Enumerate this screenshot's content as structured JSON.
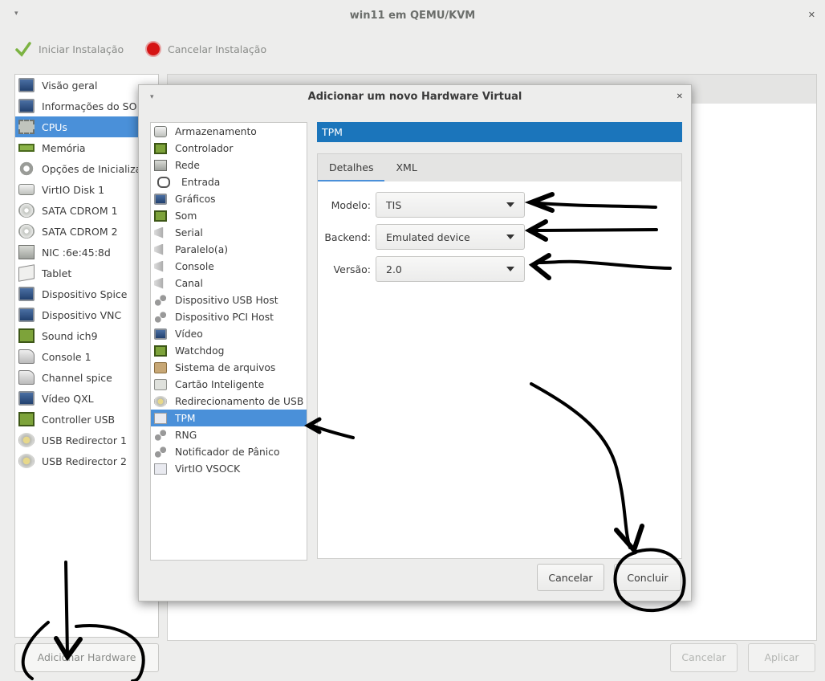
{
  "window": {
    "title": "win11 em QEMU/KVM"
  },
  "toolbar": {
    "start_label": "Iniciar Instalação",
    "cancel_label": "Cancelar Instalação"
  },
  "sidebar": {
    "items": [
      {
        "label": "Visão geral",
        "icon": "monitor-icon"
      },
      {
        "label": "Informações do SO",
        "icon": "monitor-icon"
      },
      {
        "label": "CPUs",
        "icon": "cpu-icon",
        "selected": true
      },
      {
        "label": "Memória",
        "icon": "memory-icon"
      },
      {
        "label": "Opções de Inicializa",
        "icon": "boot-icon"
      },
      {
        "label": "VirtIO Disk 1",
        "icon": "disk-icon"
      },
      {
        "label": "SATA CDROM 1",
        "icon": "cdrom-icon"
      },
      {
        "label": "SATA CDROM 2",
        "icon": "cdrom-icon"
      },
      {
        "label": "NIC :6e:45:8d",
        "icon": "nic-icon"
      },
      {
        "label": "Tablet",
        "icon": "tablet-icon"
      },
      {
        "label": "Dispositivo Spice",
        "icon": "monitor-icon"
      },
      {
        "label": "Dispositivo VNC",
        "icon": "monitor-icon"
      },
      {
        "label": "Sound ich9",
        "icon": "sound-icon"
      },
      {
        "label": "Console 1",
        "icon": "console-icon"
      },
      {
        "label": "Channel spice",
        "icon": "console-icon"
      },
      {
        "label": "Vídeo QXL",
        "icon": "monitor-icon"
      },
      {
        "label": "Controller USB",
        "icon": "controller-icon"
      },
      {
        "label": "USB Redirector 1",
        "icon": "usb-icon"
      },
      {
        "label": "USB Redirector 2",
        "icon": "usb-icon"
      }
    ]
  },
  "add_hardware_label": "Adicionar Hardware",
  "main_buttons": {
    "cancel": "Cancelar",
    "apply": "Aplicar"
  },
  "dialog": {
    "title": "Adicionar um novo Hardware Virtual",
    "hardware_list": [
      {
        "label": "Armazenamento",
        "icon": "disk-icon"
      },
      {
        "label": "Controlador",
        "icon": "controller-icon"
      },
      {
        "label": "Rede",
        "icon": "nic-icon"
      },
      {
        "label": "Entrada",
        "icon": "mouse-icon"
      },
      {
        "label": "Gráficos",
        "icon": "monitor-icon"
      },
      {
        "label": "Som",
        "icon": "sound-icon"
      },
      {
        "label": "Serial",
        "icon": "serial-icon"
      },
      {
        "label": "Paralelo(a)",
        "icon": "serial-icon"
      },
      {
        "label": "Console",
        "icon": "serial-icon"
      },
      {
        "label": "Canal",
        "icon": "serial-icon"
      },
      {
        "label": "Dispositivo USB Host",
        "icon": "pci-icon"
      },
      {
        "label": "Dispositivo PCI Host",
        "icon": "pci-icon"
      },
      {
        "label": "Vídeo",
        "icon": "monitor-icon"
      },
      {
        "label": "Watchdog",
        "icon": "watchdog-icon"
      },
      {
        "label": "Sistema de arquivos",
        "icon": "folder-icon"
      },
      {
        "label": "Cartão Inteligente",
        "icon": "smartcard-icon"
      },
      {
        "label": "Redirecionamento de USB",
        "icon": "usb-icon"
      },
      {
        "label": "TPM",
        "icon": "tpm-icon",
        "selected": true
      },
      {
        "label": "RNG",
        "icon": "pci-icon"
      },
      {
        "label": "Notificador de Pânico",
        "icon": "pci-icon"
      },
      {
        "label": "VirtIO VSOCK",
        "icon": "tpm-icon"
      }
    ],
    "header": "TPM",
    "tabs": [
      {
        "label": "Detalhes",
        "active": true
      },
      {
        "label": "XML"
      }
    ],
    "fields": [
      {
        "label": "Modelo:",
        "value": "TIS"
      },
      {
        "label": "Backend:",
        "value": "Emulated device"
      },
      {
        "label": "Versão:",
        "value": "2.0"
      }
    ],
    "buttons": {
      "cancel": "Cancelar",
      "finish": "Concluir"
    }
  },
  "colors": {
    "accent": "#4a90d9",
    "header_blue": "#1b75bb"
  }
}
